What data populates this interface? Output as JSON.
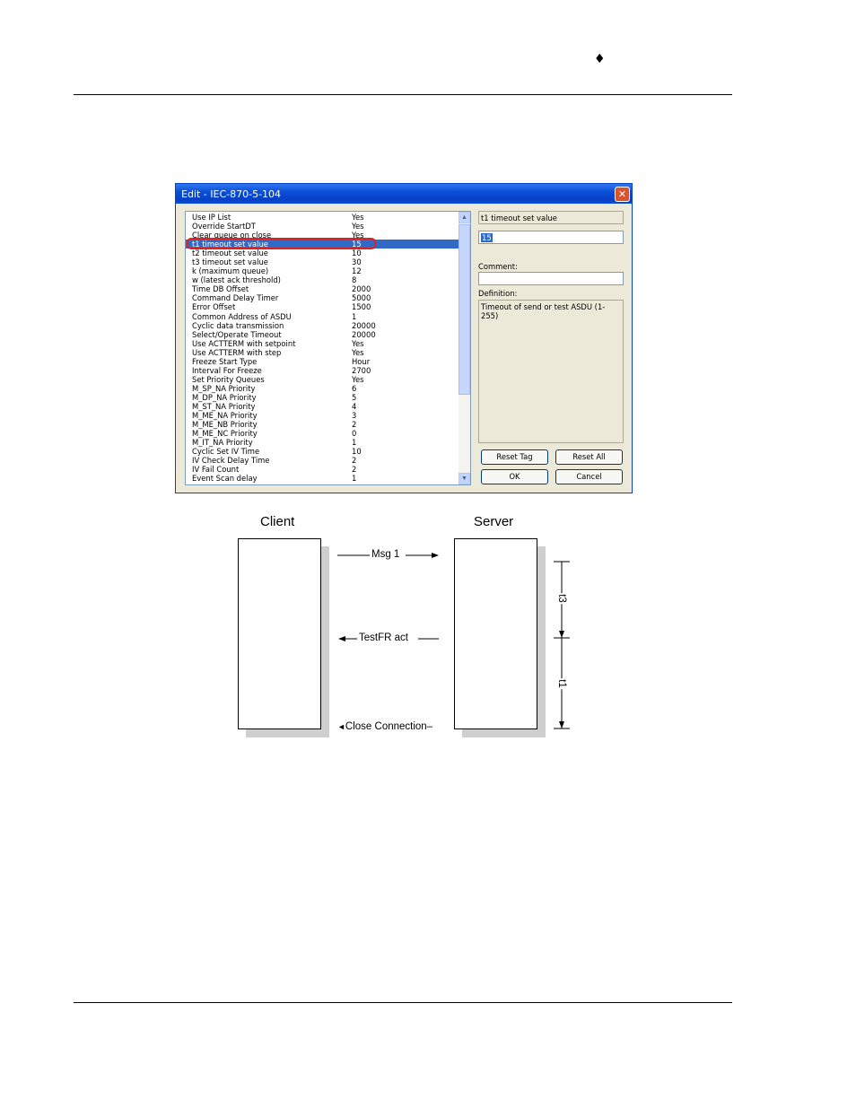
{
  "header": {
    "marker": "♦"
  },
  "dialog": {
    "title": "Edit - IEC-870-5-104",
    "close_glyph": "✕",
    "selected_index": 3,
    "rows": [
      {
        "name": "Use IP List",
        "value": "Yes"
      },
      {
        "name": "Override StartDT",
        "value": "Yes"
      },
      {
        "name": "Clear queue on close",
        "value": "Yes"
      },
      {
        "name": "t1 timeout set value",
        "value": "15"
      },
      {
        "name": "t2 timeout set value",
        "value": "10"
      },
      {
        "name": "t3 timeout set value",
        "value": "30"
      },
      {
        "name": "k (maximum queue)",
        "value": "12"
      },
      {
        "name": "w (latest ack threshold)",
        "value": "8"
      },
      {
        "name": "Time DB Offset",
        "value": "2000"
      },
      {
        "name": "Command Delay Timer",
        "value": "5000"
      },
      {
        "name": "Error Offset",
        "value": "1500"
      },
      {
        "name": "Common Address of ASDU",
        "value": "1"
      },
      {
        "name": "Cyclic data transmission",
        "value": "20000"
      },
      {
        "name": "Select/Operate Timeout",
        "value": "20000"
      },
      {
        "name": "Use ACTTERM with setpoint",
        "value": "Yes"
      },
      {
        "name": "Use ACTTERM with step",
        "value": "Yes"
      },
      {
        "name": "Freeze Start Type",
        "value": "Hour"
      },
      {
        "name": "Interval For Freeze",
        "value": "2700"
      },
      {
        "name": "Set Priority Queues",
        "value": "Yes"
      },
      {
        "name": "M_SP_NA Priority",
        "value": "6"
      },
      {
        "name": "M_DP_NA Priority",
        "value": "5"
      },
      {
        "name": "M_ST_NA Priority",
        "value": "4"
      },
      {
        "name": "M_ME_NA Priority",
        "value": "3"
      },
      {
        "name": "M_ME_NB Priority",
        "value": "2"
      },
      {
        "name": "M_ME_NC Priority",
        "value": "0"
      },
      {
        "name": "M_IT_NA Priority",
        "value": "1"
      },
      {
        "name": "Cyclic Set IV Time",
        "value": "10"
      },
      {
        "name": "IV Check Delay Time",
        "value": "2"
      },
      {
        "name": "IV Fail Count",
        "value": "2"
      },
      {
        "name": "Event Scan delay",
        "value": "1"
      }
    ],
    "scroll_up": "▲",
    "scroll_down": "▼",
    "param_name": "t1 timeout set value",
    "value_field": "15",
    "comment_label": "Comment:",
    "comment_value": "",
    "definition_label": "Definition:",
    "definition_text": "Timeout of send or test ASDU (1-255)",
    "buttons": {
      "reset_tag": "Reset Tag",
      "reset_all": "Reset All",
      "ok": "OK",
      "cancel": "Cancel"
    }
  },
  "diagram": {
    "client_label": "Client",
    "server_label": "Server",
    "msg1": "Msg 1",
    "testfr": "TestFR act",
    "close_conn": "Close Connection",
    "t3_label": "t3",
    "t1_label": "t1"
  }
}
